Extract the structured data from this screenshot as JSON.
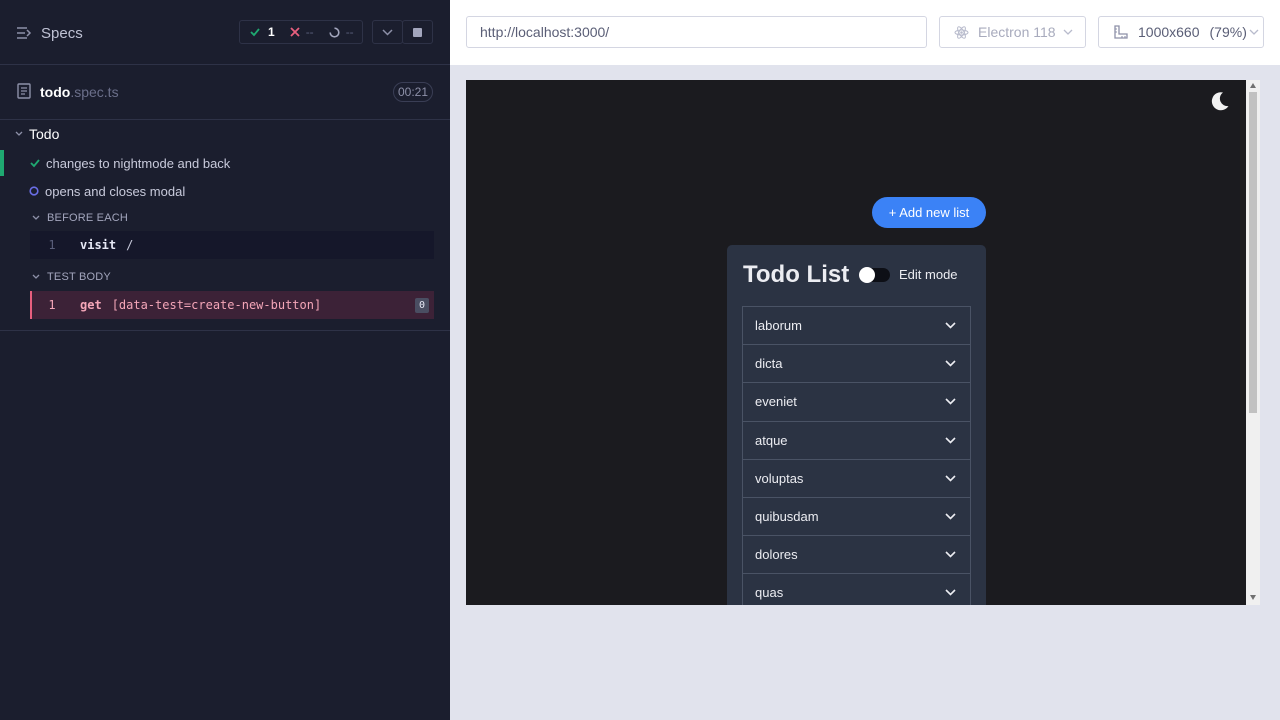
{
  "reporter": {
    "specs_label": "Specs",
    "stats": {
      "passed": "1",
      "failed": "--",
      "pending": "--"
    },
    "spec": {
      "name": "todo",
      "ext": ".spec.ts",
      "duration": "00:21"
    },
    "suite": "Todo",
    "tests": [
      {
        "title": "changes to nightmode and back",
        "state": "passed"
      },
      {
        "title": "opens and closes modal",
        "state": "running"
      }
    ],
    "hooks": {
      "before_each": {
        "label": "BEFORE EACH",
        "commands": [
          {
            "number": "1",
            "name": "visit",
            "arg": "/"
          }
        ]
      },
      "test_body": {
        "label": "TEST BODY",
        "commands": [
          {
            "number": "1",
            "name": "get",
            "arg": "[data-test=create-new-button]",
            "count": "0"
          }
        ]
      }
    }
  },
  "aut_header": {
    "url": "http://localhost:3000/",
    "browser": "Electron 118",
    "viewport": "1000x660",
    "zoom": "(79%)"
  },
  "app": {
    "add_button": "+ Add new list",
    "title": "Todo List",
    "edit_mode_label": "Edit mode",
    "edit_mode_on": false,
    "lists": [
      "laborum",
      "dicta",
      "eveniet",
      "atque",
      "voluptas",
      "quibusdam",
      "dolores",
      "quas"
    ]
  },
  "colors": {
    "passed": "#1fa971",
    "failed": "#e85f7e",
    "accent": "#3b82f6"
  }
}
